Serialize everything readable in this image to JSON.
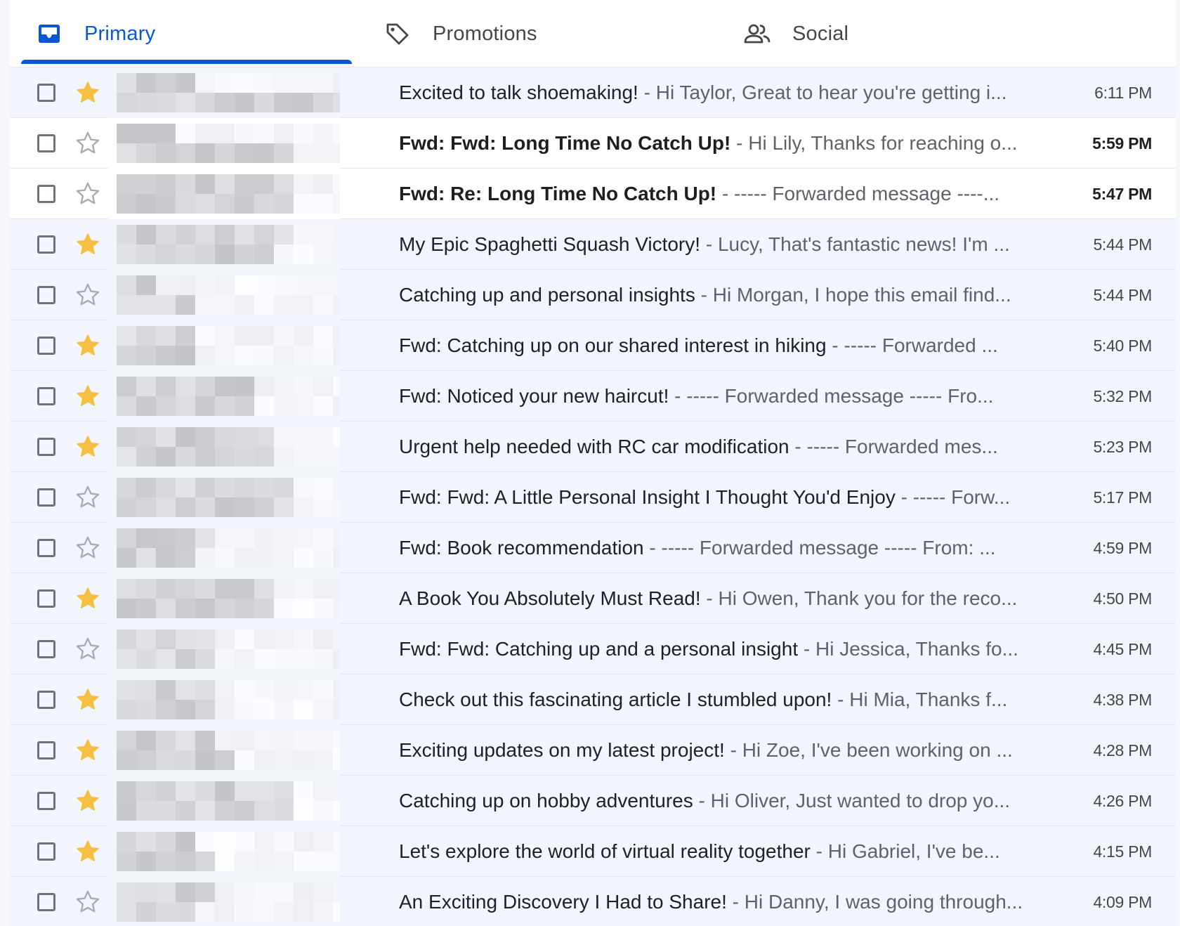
{
  "tabs": [
    {
      "label": "Primary",
      "icon": "inbox-icon",
      "active": true
    },
    {
      "label": "Promotions",
      "icon": "tag-icon",
      "active": false
    },
    {
      "label": "Social",
      "icon": "people-icon",
      "active": false
    }
  ],
  "colors": {
    "accent": "#0b57d0",
    "star_on": "#f6bf42",
    "star_off": "#a8adb3",
    "read_row": "#f2f6fc",
    "unread_row": "#ffffff"
  },
  "emails": [
    {
      "subject": "Excited to talk shoemaking!",
      "snippet": "Hi Taylor, Great to hear you're getting i...",
      "time": "6:11 PM",
      "starred": true,
      "unread": false
    },
    {
      "subject": "Fwd: Fwd: Long Time No Catch Up!",
      "snippet": "Hi Lily, Thanks for reaching o...",
      "time": "5:59 PM",
      "starred": false,
      "unread": true
    },
    {
      "subject": "Fwd: Re: Long Time No Catch Up!",
      "snippet": "----- Forwarded message ----...",
      "time": "5:47 PM",
      "starred": false,
      "unread": true
    },
    {
      "subject": "My Epic Spaghetti Squash Victory!",
      "snippet": "Lucy, That's fantastic news! I'm ...",
      "time": "5:44 PM",
      "starred": true,
      "unread": false
    },
    {
      "subject": "Catching up and personal insights",
      "snippet": "Hi Morgan, I hope this email find...",
      "time": "5:44 PM",
      "starred": false,
      "unread": false
    },
    {
      "subject": "Fwd: Catching up on our shared interest in hiking",
      "snippet": "----- Forwarded ...",
      "time": "5:40 PM",
      "starred": true,
      "unread": false
    },
    {
      "subject": "Fwd: Noticed your new haircut!",
      "snippet": "----- Forwarded message ----- Fro...",
      "time": "5:32 PM",
      "starred": true,
      "unread": false
    },
    {
      "subject": "Urgent help needed with RC car modification",
      "snippet": "----- Forwarded mes...",
      "time": "5:23 PM",
      "starred": true,
      "unread": false
    },
    {
      "subject": "Fwd: Fwd: A Little Personal Insight I Thought You'd Enjoy",
      "snippet": "----- Forw...",
      "time": "5:17 PM",
      "starred": false,
      "unread": false
    },
    {
      "subject": "Fwd: Book recommendation",
      "snippet": "----- Forwarded message ----- From: ...",
      "time": "4:59 PM",
      "starred": false,
      "unread": false
    },
    {
      "subject": "A Book You Absolutely Must Read!",
      "snippet": "Hi Owen, Thank you for the reco...",
      "time": "4:50 PM",
      "starred": true,
      "unread": false
    },
    {
      "subject": "Fwd: Fwd: Catching up and a personal insight",
      "snippet": "Hi Jessica, Thanks fo...",
      "time": "4:45 PM",
      "starred": false,
      "unread": false
    },
    {
      "subject": "Check out this fascinating article I stumbled upon!",
      "snippet": "Hi Mia, Thanks f...",
      "time": "4:38 PM",
      "starred": true,
      "unread": false
    },
    {
      "subject": "Exciting updates on my latest project!",
      "snippet": "Hi Zoe, I've been working on ...",
      "time": "4:28 PM",
      "starred": true,
      "unread": false
    },
    {
      "subject": "Catching up on hobby adventures",
      "snippet": "Hi Oliver, Just wanted to drop yo...",
      "time": "4:26 PM",
      "starred": true,
      "unread": false
    },
    {
      "subject": "Let's explore the world of virtual reality together",
      "snippet": "Hi Gabriel, I've be...",
      "time": "4:15 PM",
      "starred": true,
      "unread": false
    },
    {
      "subject": "An Exciting Discovery I Had to Share!",
      "snippet": "Hi Danny, I was going through...",
      "time": "4:09 PM",
      "starred": false,
      "unread": false
    }
  ],
  "separator": " - "
}
